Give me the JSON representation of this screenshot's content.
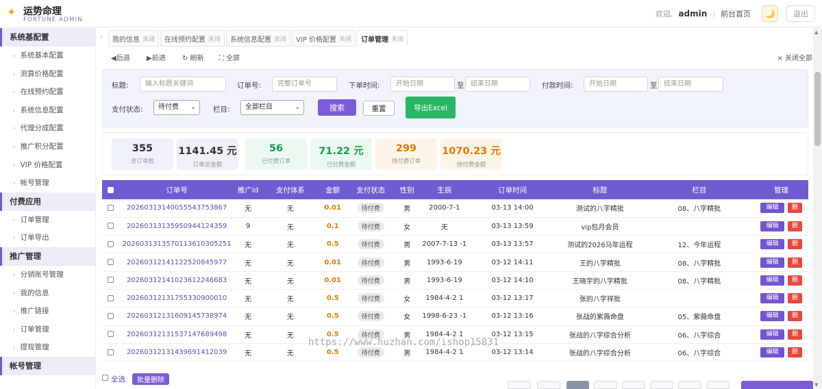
{
  "logo": {
    "name": "运势命理",
    "subtitle": "FORTUNE ADMIN"
  },
  "header": {
    "welcome": "欢迎,",
    "user": "admin",
    "front_link": "前台首页",
    "logout": "退出",
    "theme_icon": "moon-icon"
  },
  "sidebar": {
    "groups": [
      {
        "title": "系统基配置",
        "items": [
          "系统基本配置",
          "测算价格配置",
          "在线预约配置",
          "系统信息配置",
          "代理分成配置",
          "推广积分配置",
          "VIP 价格配置",
          "帐号管理"
        ]
      },
      {
        "title": "付费应用",
        "items": [
          "订单管理",
          "订单导出"
        ]
      },
      {
        "title": "推广管理",
        "items": [
          "分销账号管理",
          "我的信息",
          "推广链接",
          "订单管理",
          "提现管理"
        ]
      },
      {
        "title": "帐号管理",
        "items": []
      }
    ]
  },
  "tabs": [
    {
      "label": "我的信息",
      "close": "关闭"
    },
    {
      "label": "在线预约配置",
      "close": "关闭"
    },
    {
      "label": "系统信息配置",
      "close": "关闭"
    },
    {
      "label": "VIP 价格配置",
      "close": "关闭"
    },
    {
      "label": "订单管理",
      "close": "关闭",
      "active": true
    }
  ],
  "nav": {
    "back": "◀后退",
    "forward": "▶前进",
    "refresh": "↻ 刷新",
    "fullscreen": "⛶ 全屏",
    "close_all": "× 关闭全部"
  },
  "filter": {
    "title_label": "标题:",
    "title_placeholder": "输入标题关键词",
    "order_no_label": "订单号:",
    "order_no_placeholder": "完整订单号",
    "order_time_label": "下单时间:",
    "start_date": "开始日期",
    "to": "至",
    "end_date": "结束日期",
    "pay_time_label": "付款时间:",
    "pay_status_label": "支付状态:",
    "pay_status_value": "待付费",
    "column_label": "栏目:",
    "column_value": "全部栏目",
    "search_btn": "搜索",
    "reset_btn": "重置",
    "export_btn": "导出Excel"
  },
  "stats": [
    {
      "value": "355",
      "label": "总订单数",
      "color": "#333333",
      "bg": "#eef1fa"
    },
    {
      "value": "1141.45 元",
      "label": "订单总金额",
      "color": "#333333",
      "bg": "#eef1fa"
    },
    {
      "value": "56",
      "label": "已付费订单",
      "color": "#1a9a4c",
      "bg": "#ebf8f0"
    },
    {
      "value": "71.22 元",
      "label": "已付费金额",
      "color": "#1a9a4c",
      "bg": "#ebf8f0"
    },
    {
      "value": "299",
      "label": "待付费订单",
      "color": "#e07b00",
      "bg": "#fdf3e7"
    },
    {
      "value": "1070.23 元",
      "label": "待付费金额",
      "color": "#e07b00",
      "bg": "#fdf3e7"
    }
  ],
  "table": {
    "headers": [
      "订单号",
      "推广id",
      "支付体系",
      "金额",
      "支付状态",
      "性别",
      "生辰",
      "订单时间",
      "标题",
      "栏目",
      "管理"
    ],
    "edit_label": "编辑",
    "delete_label": "删",
    "rows": [
      {
        "order_no": "20260313140055543753867",
        "promo_id": "无",
        "pay_system": "无",
        "amount": "0.01",
        "status": "待付费",
        "gender": "男",
        "birth": "2000-7-1",
        "time": "03-13 14:00",
        "title": "测试的八字精批",
        "column": "08、八字精批"
      },
      {
        "order_no": "20260313135950944124359",
        "promo_id": "9",
        "pay_system": "无",
        "amount": "0.1",
        "status": "待付费",
        "gender": "女",
        "birth": "无",
        "time": "03-13 13:59",
        "title": "vip包月会员",
        "column": ""
      },
      {
        "order_no": "2026031313570113610305251",
        "promo_id": "无",
        "pay_system": "无",
        "amount": "0.5",
        "status": "待付费",
        "gender": "男",
        "birth": "2007-7-13 -1",
        "time": "03-13 13:57",
        "title": "测试的2026马年运程",
        "column": "12、今年运程"
      },
      {
        "order_no": "20260312141122520845977",
        "promo_id": "无",
        "pay_system": "无",
        "amount": "0.01",
        "status": "待付费",
        "gender": "男",
        "birth": "1993-6-19",
        "time": "03-12 14:11",
        "title": "王的八字精批",
        "column": "08、八字精批"
      },
      {
        "order_no": "20260312141023612246683",
        "promo_id": "无",
        "pay_system": "无",
        "amount": "0.01",
        "status": "待付费",
        "gender": "男",
        "birth": "1993-6-19",
        "time": "03-12 14:10",
        "title": "王晓宇的八字精批",
        "column": "08、八字精批"
      },
      {
        "order_no": "20260312131755330900010",
        "promo_id": "无",
        "pay_system": "无",
        "amount": "0.5",
        "status": "待付费",
        "gender": "女",
        "birth": "1984-4-2 1",
        "time": "03-12 13:17",
        "title": "张的八字祥批",
        "column": ""
      },
      {
        "order_no": "20260312131609145738974",
        "promo_id": "无",
        "pay_system": "无",
        "amount": "0.5",
        "status": "待付费",
        "gender": "女",
        "birth": "1998-6-23 -1",
        "time": "03-12 13:16",
        "title": "张战的紫薇命盘",
        "column": "05、紫薇命盘"
      },
      {
        "order_no": "20260312131537147689498",
        "promo_id": "无",
        "pay_system": "无",
        "amount": "0.5",
        "status": "待付费",
        "gender": "男",
        "birth": "1984-4-2 1",
        "time": "03-12 13:15",
        "title": "张战的八字综合分析",
        "column": "06、八字综合"
      },
      {
        "order_no": "20260312131439691412039",
        "promo_id": "无",
        "pay_system": "无",
        "amount": "0.5",
        "status": "待付费",
        "gender": "男",
        "birth": "1984-4-2 1",
        "time": "03-12 13:14",
        "title": "张战的八字综合分析",
        "column": "06、八字综合"
      }
    ]
  },
  "watermark": "https://www.huzhan.com/ishop15831",
  "footer": {
    "select_all": "全选",
    "batch_delete": "批量删除"
  }
}
